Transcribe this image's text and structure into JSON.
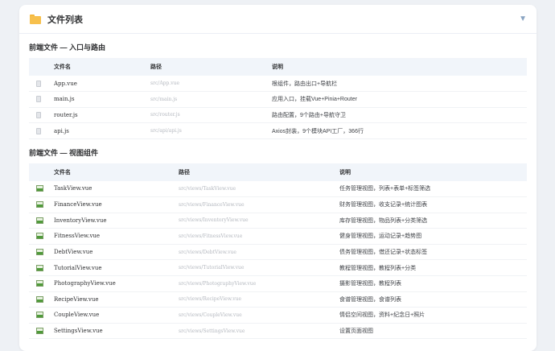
{
  "panel": {
    "title": "文件列表",
    "folder_icon": "folder-icon",
    "collapse_icon": "▼"
  },
  "sections": [
    {
      "title": "前端文件 — 入口与路由",
      "headers": [
        "文件名",
        "路径",
        "说明"
      ],
      "rows": [
        {
          "icon": "file-icon",
          "name": "App.vue",
          "path": "src/App.vue",
          "desc": "根组件，路由出口+导航栏"
        },
        {
          "icon": "file-icon",
          "name": "main.js",
          "path": "src/main.js",
          "desc": "应用入口，挂载Vue+Pinia+Router"
        },
        {
          "icon": "file-icon",
          "name": "router.js",
          "path": "src/router.js",
          "desc": "路由配置，9个路由+导航守卫"
        },
        {
          "icon": "file-icon",
          "name": "api.js",
          "path": "src/api/api.js",
          "desc": "Axios封装，9个模块API工厂，366行"
        }
      ]
    },
    {
      "title": "前端文件 — 视图组件",
      "headers": [
        "文件名",
        "路径",
        "说明"
      ],
      "rows": [
        {
          "icon": "image-icon",
          "name": "TaskView.vue",
          "path": "src/views/TaskView.vue",
          "desc": "任务管理视图，列表+表单+标签筛选"
        },
        {
          "icon": "image-icon",
          "name": "FinanceView.vue",
          "path": "src/views/FinanceView.vue",
          "desc": "财务管理视图，收支记录+统计图表"
        },
        {
          "icon": "image-icon",
          "name": "InventoryView.vue",
          "path": "src/views/InventoryView.vue",
          "desc": "库存管理视图，物品列表+分类筛选"
        },
        {
          "icon": "image-icon",
          "name": "FitnessView.vue",
          "path": "src/views/FitnessView.vue",
          "desc": "健身管理视图，运动记录+趋势图"
        },
        {
          "icon": "image-icon",
          "name": "DebtView.vue",
          "path": "src/views/DebtView.vue",
          "desc": "债务管理视图，借还记录+状态标签"
        },
        {
          "icon": "image-icon",
          "name": "TutorialView.vue",
          "path": "src/views/TutorialView.vue",
          "desc": "教程管理视图，教程列表+分类"
        },
        {
          "icon": "image-icon",
          "name": "PhotographyView.vue",
          "path": "src/views/PhotographyView.vue",
          "desc": "摄影管理视图，教程列表"
        },
        {
          "icon": "image-icon",
          "name": "RecipeView.vue",
          "path": "src/views/RecipeView.vue",
          "desc": "食谱管理视图，食谱列表"
        },
        {
          "icon": "image-icon",
          "name": "CoupleView.vue",
          "path": "src/views/CoupleView.vue",
          "desc": "情侣空间视图，资料+纪念日+照片"
        },
        {
          "icon": "image-icon",
          "name": "SettingsView.vue",
          "path": "src/views/SettingsView.vue",
          "desc": "设置页面视图"
        }
      ]
    }
  ]
}
